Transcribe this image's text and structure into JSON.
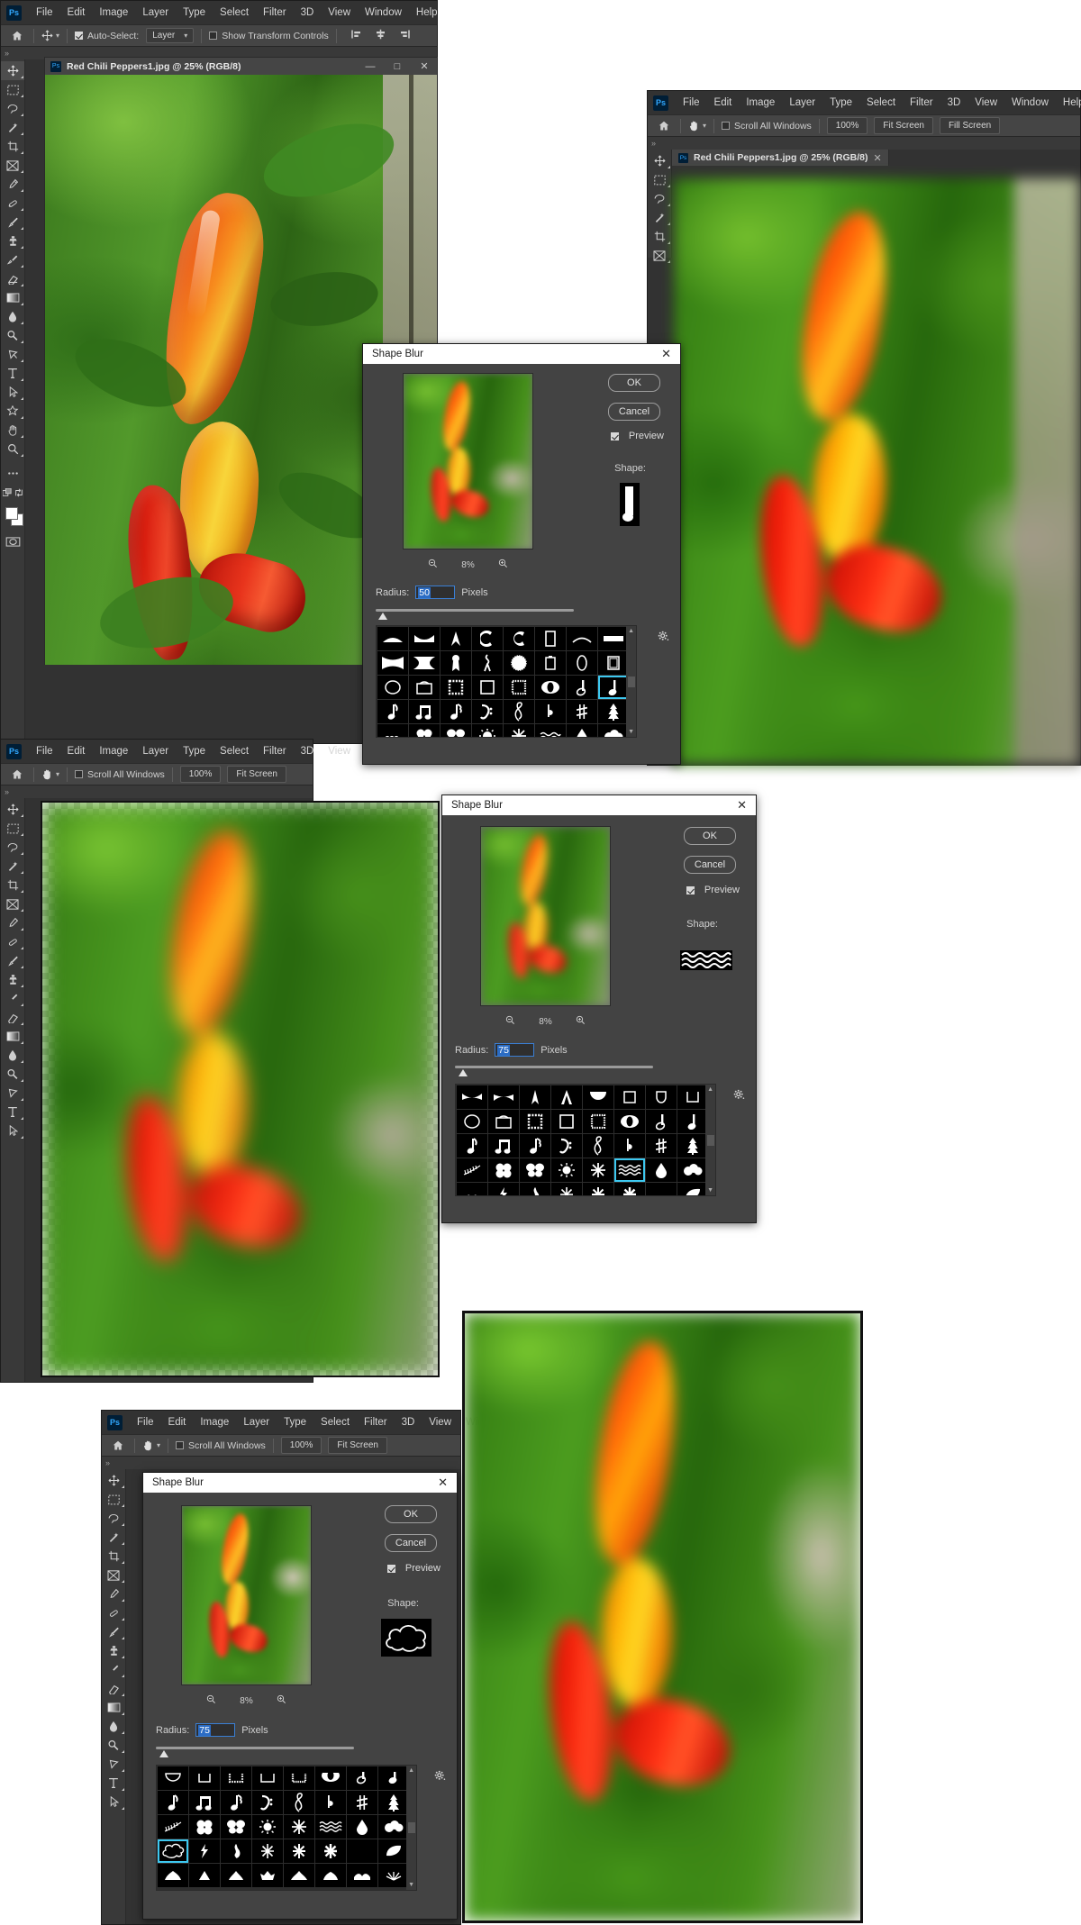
{
  "app": {
    "name": "Adobe Photoshop",
    "logo_text": "Ps"
  },
  "menus": {
    "full": [
      "File",
      "Edit",
      "Image",
      "Layer",
      "Type",
      "Select",
      "Filter",
      "3D",
      "View",
      "Window",
      "Help"
    ],
    "short": [
      "File",
      "Edit",
      "Image",
      "Layer",
      "Type",
      "Select",
      "Filter",
      "3D",
      "View"
    ],
    "bottom": [
      "File",
      "Edit",
      "Image",
      "Layer",
      "Type",
      "Select",
      "Filter",
      "3D",
      "View",
      "Window"
    ]
  },
  "document": {
    "title": "Red Chili Peppers1.jpg @ 25% (RGB/8)",
    "filename": "Red Chili Peppers1.jpg",
    "zoom": "25%",
    "mode": "RGB/8"
  },
  "window1": {
    "option_bar": {
      "home_icon": "home-icon",
      "tool_icon": "move-tool-icon",
      "auto_select_label": "Auto-Select:",
      "auto_select_checked": true,
      "layer_select_value": "Layer",
      "show_transform_label": "Show Transform Controls",
      "show_transform_checked": false,
      "align_icons": [
        "align-left-icon",
        "align-center-icon",
        "align-right-icon"
      ]
    },
    "title_bar": {
      "minimize": "minimize-icon",
      "maximize": "maximize-icon",
      "close": "close-icon"
    }
  },
  "hand_tool_bar": {
    "home_icon": "home-icon",
    "tool_icon": "hand-tool-icon",
    "scroll_all_label": "Scroll All Windows",
    "scroll_all_checked": false,
    "zoom_100_label": "100%",
    "fit_screen_label": "Fit Screen",
    "fill_screen_label": "Fill Screen"
  },
  "toolbar_tools": [
    "move-tool-icon",
    "rectangular-marquee-icon",
    "lasso-icon",
    "magic-wand-icon",
    "crop-tool-icon",
    "frame-tool-icon",
    "eyedropper-icon",
    "healing-brush-icon",
    "brush-tool-icon",
    "clone-stamp-icon",
    "history-brush-icon",
    "eraser-tool-icon",
    "gradient-tool-icon",
    "blur-tool-icon",
    "dodge-tool-icon",
    "pen-tool-icon",
    "type-tool-icon",
    "path-selection-icon",
    "shape-tool-icon",
    "hand-tool-icon",
    "zoom-tool-icon",
    "more-tools-icon",
    "edit-toolbar-icon"
  ],
  "dialogs": [
    {
      "id": "dialog-1",
      "title": "Shape Blur",
      "close_icon": "close-icon",
      "ok_label": "OK",
      "cancel_label": "Cancel",
      "preview_label": "Preview",
      "preview_checked": true,
      "zoom_out_icon": "zoom-out-icon",
      "zoom_in_icon": "zoom-in-icon",
      "zoom_level": "8%",
      "radius_label": "Radius:",
      "radius_value": "50",
      "radius_units": "Pixels",
      "shape_label": "Shape:",
      "selected_shape": "quarter-note",
      "gear_icon": "gear-icon",
      "scroll_up_icon": "chevron-up-icon",
      "scroll_down_icon": "chevron-down-icon"
    },
    {
      "id": "dialog-2",
      "title": "Shape Blur",
      "close_icon": "close-icon",
      "ok_label": "OK",
      "cancel_label": "Cancel",
      "preview_label": "Preview",
      "preview_checked": true,
      "zoom_out_icon": "zoom-out-icon",
      "zoom_in_icon": "zoom-in-icon",
      "zoom_level": "8%",
      "radius_label": "Radius:",
      "radius_value": "75",
      "radius_units": "Pixels",
      "shape_label": "Shape:",
      "selected_shape": "waves",
      "gear_icon": "gear-icon",
      "scroll_up_icon": "chevron-up-icon",
      "scroll_down_icon": "chevron-down-icon"
    },
    {
      "id": "dialog-3",
      "title": "Shape Blur",
      "close_icon": "close-icon",
      "ok_label": "OK",
      "cancel_label": "Cancel",
      "preview_label": "Preview",
      "preview_checked": true,
      "zoom_out_icon": "zoom-out-icon",
      "zoom_in_icon": "zoom-in-icon",
      "zoom_level": "8%",
      "radius_label": "Radius:",
      "radius_value": "75",
      "radius_units": "Pixels",
      "shape_label": "Shape:",
      "selected_shape": "cloud-outline",
      "gear_icon": "gear-icon",
      "scroll_up_icon": "chevron-up-icon",
      "scroll_down_icon": "chevron-down-icon"
    }
  ],
  "colors": {
    "accent_blue": "#31a8ff",
    "selection_blue": "#3dc8f0",
    "field_blue": "#2b6cc4",
    "panel_bg": "#434343",
    "chrome_bg": "#323232",
    "option_bar_bg": "#454545",
    "dialog_title_bg": "#ffffff"
  }
}
